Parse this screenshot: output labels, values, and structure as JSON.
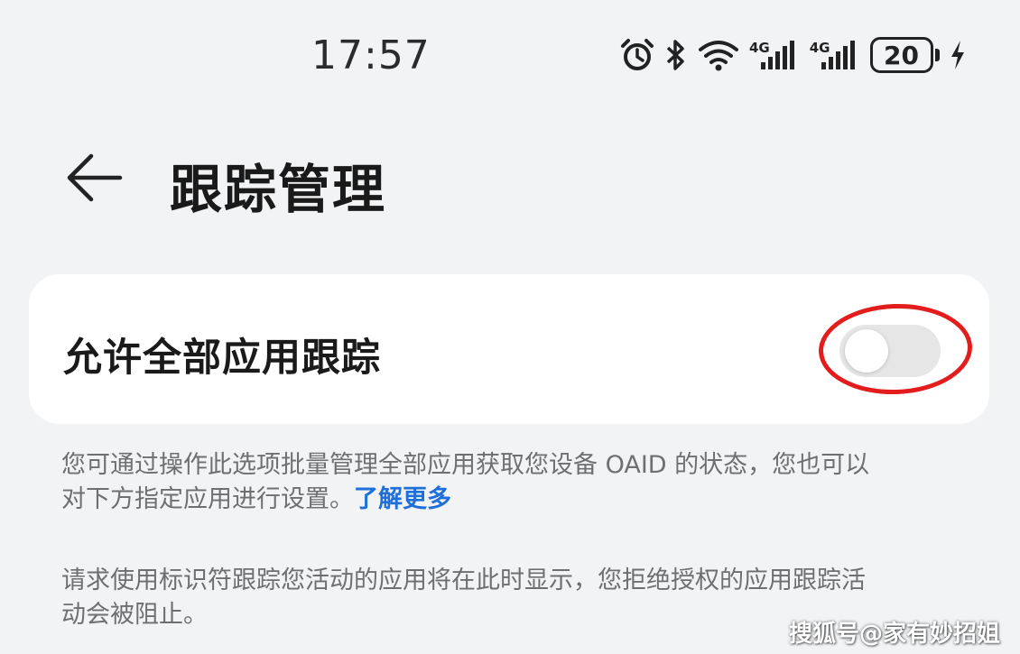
{
  "status_bar": {
    "time": "17:57",
    "icons": [
      "alarm-icon",
      "bluetooth-icon",
      "wifi-icon",
      "signal-4g-icon",
      "signal-4g-icon",
      "battery-icon",
      "charging-icon"
    ],
    "network_label_1": "4G",
    "network_label_2": "4G",
    "battery_level": "20"
  },
  "header": {
    "back_icon": "back-arrow-icon",
    "title": "跟踪管理"
  },
  "setting": {
    "label": "允许全部应用跟踪",
    "enabled": false
  },
  "description_1": {
    "line_1": "您可通过操作此选项批量管理全部应用获取您设备 OAID 的状态，您也可以",
    "line_2": "对下方指定应用进行设置。",
    "link": "了解更多"
  },
  "description_2": {
    "line_1": "请求使用标识符跟踪您活动的应用将在此时显示，您拒绝授权的应用跟踪活",
    "line_2": "动会被阻止。"
  },
  "annotation_color": "#e31d1d",
  "accent_color": "#1e6fd9",
  "watermark": "搜狐号@家有妙招姐"
}
